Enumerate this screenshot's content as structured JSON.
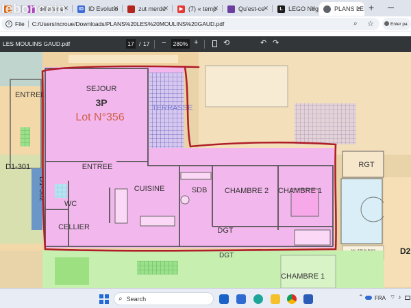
{
  "browser": {
    "watermark": "leboncoin",
    "tabs": [
      {
        "title": "",
        "icon": "leboncoin-icon",
        "color": "#e8711a"
      },
      {
        "title": "Billetterie",
        "icon": "ticket-icon",
        "color": "#b04ac8"
      },
      {
        "title": "ID Evolutio",
        "icon": "id-evolution-icon",
        "color": "#3f6bd8"
      },
      {
        "title": "zut merde",
        "icon": "tv-icon",
        "color": "#b3261e"
      },
      {
        "title": "(7) « temp",
        "icon": "youtube-icon",
        "color": "#e53935"
      },
      {
        "title": "Qu'est-ce",
        "icon": "globe-icon",
        "color": "#6b3fa0"
      },
      {
        "title": "LEGO Nego",
        "icon": "lego-icon",
        "color": "#1c1c1c"
      },
      {
        "title": "PLANS LES",
        "icon": "globe-icon",
        "color": "#5f6368",
        "active": true
      }
    ],
    "new_tab": "+",
    "address_prefix": "File",
    "url": "C:/Users/ncroue/Downloads/PLANS%20LES%20MOULINS%20GAUD.pdf",
    "profile_label": "Enter pa"
  },
  "pdf": {
    "doc_title": "LES MOULINS GAUD.pdf",
    "page_current": "17",
    "page_sep": "/",
    "page_total": "17",
    "zoom": "280%",
    "zoom_out": "−",
    "zoom_in": "+"
  },
  "plan": {
    "rooms": {
      "sejour": "SEJOUR",
      "type": "3P",
      "lot": "Lot N°356",
      "terrasse": "TERRASSE",
      "entree_left": "ENTREE",
      "entree": "ENTREE",
      "cuisine": "CUISINE",
      "wc": "WC",
      "cellier": "CELLIER",
      "sdb": "SDB",
      "chambre2": "CHAMBRE 2",
      "chambre1": "CHAMBRE 1",
      "dgt": "DGT",
      "dgt_bottom": "DGT",
      "chambre1_bottom": "CHAMBRE 1",
      "rgt": "RGT",
      "d1_301": "D1-301",
      "d1_302": "D1-302",
      "d2": "D2",
      "asc": "Asc. 630 kg 8pers"
    }
  },
  "taskbar": {
    "search_placeholder": "Search",
    "lang": "FRA"
  }
}
